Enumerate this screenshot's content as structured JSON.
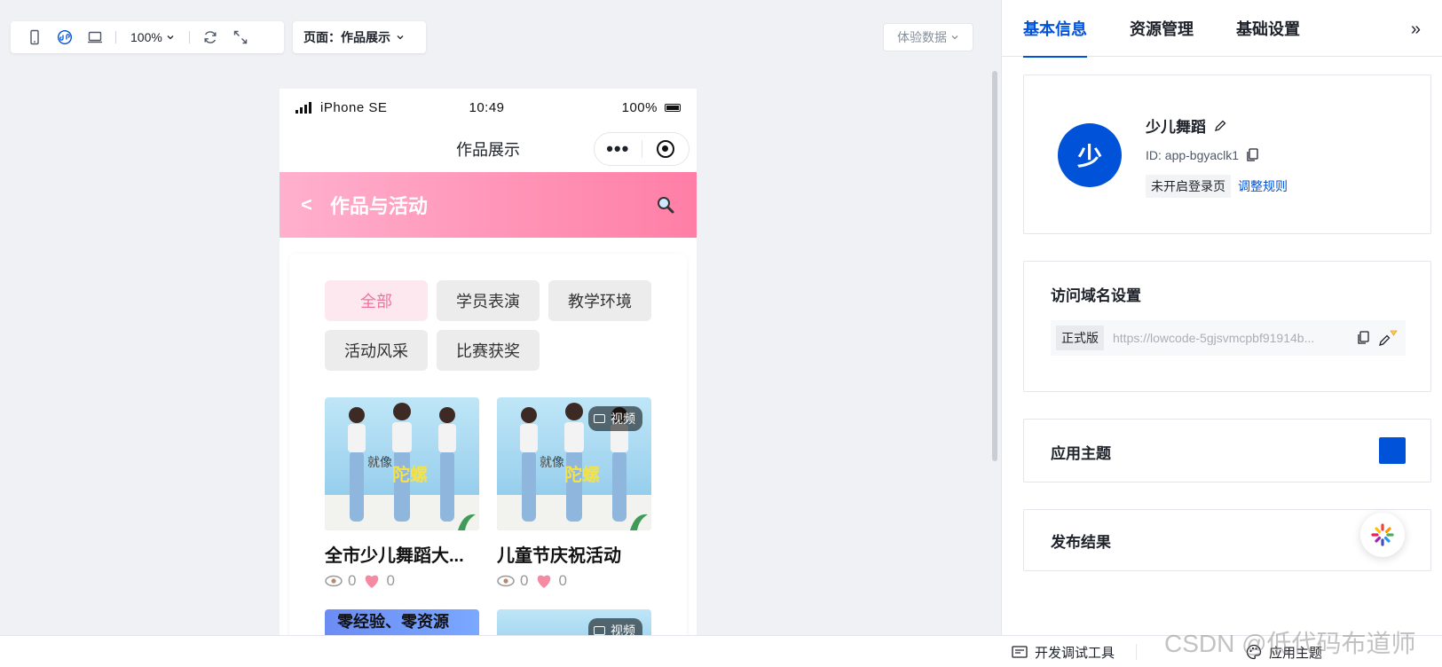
{
  "toolbar": {
    "zoom": "100%",
    "page_label": "页面：作品展示",
    "experience_data": "体验数据"
  },
  "phone": {
    "device": "iPhone SE",
    "time": "10:49",
    "battery": "100%",
    "nav_title": "作品展示",
    "header_title": "作品与活动",
    "filters": [
      "全部",
      "学员表演",
      "教学环境",
      "活动风采",
      "比赛获奖"
    ],
    "active_filter": "全部",
    "items": [
      {
        "title": "全市少儿舞蹈大...",
        "views": "0",
        "likes": "0",
        "video": ""
      },
      {
        "title": "儿童节庆祝活动",
        "views": "0",
        "likes": "0",
        "video": "视频"
      }
    ],
    "thumb_text_left": "就像",
    "thumb_text_right": "陀螺",
    "partial_item_text": "零经验、零资源",
    "partial_video": "视频"
  },
  "panel": {
    "tabs": [
      "基本信息",
      "资源管理",
      "基础设置"
    ],
    "active_tab": "基本信息",
    "app": {
      "avatar_char": "少",
      "name": "少儿舞蹈",
      "id": "ID: app-bgyaclk1",
      "login_status": "未开启登录页",
      "adjust_rule": "调整规则"
    },
    "domain": {
      "title": "访问域名设置",
      "version": "正式版",
      "url": "https://lowcode-5gjsvmcpbf91914b..."
    },
    "theme": {
      "title": "应用主题",
      "color": "#0052d9"
    },
    "publish": {
      "title": "发布结果"
    }
  },
  "bottom": {
    "dev_tools": "开发调试工具",
    "app_theme": "应用主题"
  },
  "watermark": "CSDN @低代码布道师",
  "colors": {
    "accent": "#0052d9",
    "pink": "#ff7ea6",
    "chip_active_bg": "#fde8ef"
  }
}
